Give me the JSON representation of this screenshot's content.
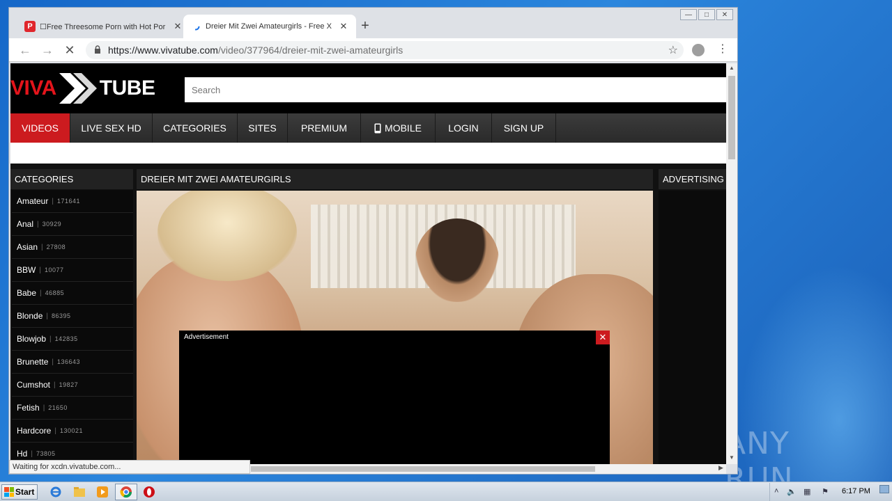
{
  "browser": {
    "tabs": [
      {
        "title": "☐Free Threesome Porn with Hot Por",
        "favicon": "P",
        "active": false
      },
      {
        "title": "Dreier Mit Zwei Amateurgirls - Free X",
        "active": true
      }
    ],
    "new_tab": "+",
    "url_host": "https://www.vivatube.com",
    "url_path": "/video/377964/dreier-mit-zwei-amateurgirls",
    "status_text": "Waiting for xcdn.vivatube.com..."
  },
  "site": {
    "logo_viva": "VIVA",
    "logo_tube": "TUBE",
    "search_placeholder": "Search",
    "nav": [
      {
        "label": "VIDEOS",
        "active": true
      },
      {
        "label": "LIVE SEX HD"
      },
      {
        "label": "CATEGORIES"
      },
      {
        "label": "SITES"
      },
      {
        "label": "PREMIUM"
      },
      {
        "label": "MOBILE",
        "icon": "phone-icon"
      },
      {
        "label": "LOGIN"
      },
      {
        "label": "SIGN UP"
      }
    ],
    "categories_title": "CATEGORIES",
    "categories": [
      {
        "name": "Amateur",
        "count": "171641"
      },
      {
        "name": "Anal",
        "count": "30929"
      },
      {
        "name": "Asian",
        "count": "27808"
      },
      {
        "name": "BBW",
        "count": "10077"
      },
      {
        "name": "Babe",
        "count": "46885"
      },
      {
        "name": "Blonde",
        "count": "86395"
      },
      {
        "name": "Blowjob",
        "count": "142835"
      },
      {
        "name": "Brunette",
        "count": "136643"
      },
      {
        "name": "Cumshot",
        "count": "19827"
      },
      {
        "name": "Fetish",
        "count": "21650"
      },
      {
        "name": "Hardcore",
        "count": "130021"
      },
      {
        "name": "Hd",
        "count": "73805"
      }
    ],
    "video_title": "DREIER MIT ZWEI AMATEURGIRLS",
    "ad_label": "Advertisement",
    "ad_close": "✕",
    "advertising_title": "ADVERTISING"
  },
  "taskbar": {
    "start_label": "Start",
    "clock": "6:17 PM"
  },
  "watermark": "ANY RUN",
  "colors": {
    "brand_red": "#cc1b1f",
    "header_bg": "#000000"
  }
}
